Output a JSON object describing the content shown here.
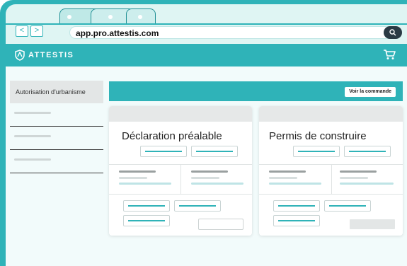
{
  "browser": {
    "url": "app.pro.attestis.com",
    "back_label": "<",
    "forward_label": ">"
  },
  "app": {
    "brand": "ATTESTIS",
    "order_button": "Voir la commande"
  },
  "sidebar": {
    "active_item": "Autorisation d'urbanisme"
  },
  "cards": [
    {
      "title": "Déclaration préalable"
    },
    {
      "title": "Permis de construire"
    }
  ],
  "colors": {
    "accent": "#2fb3b8",
    "dark": "#2a3a44"
  }
}
